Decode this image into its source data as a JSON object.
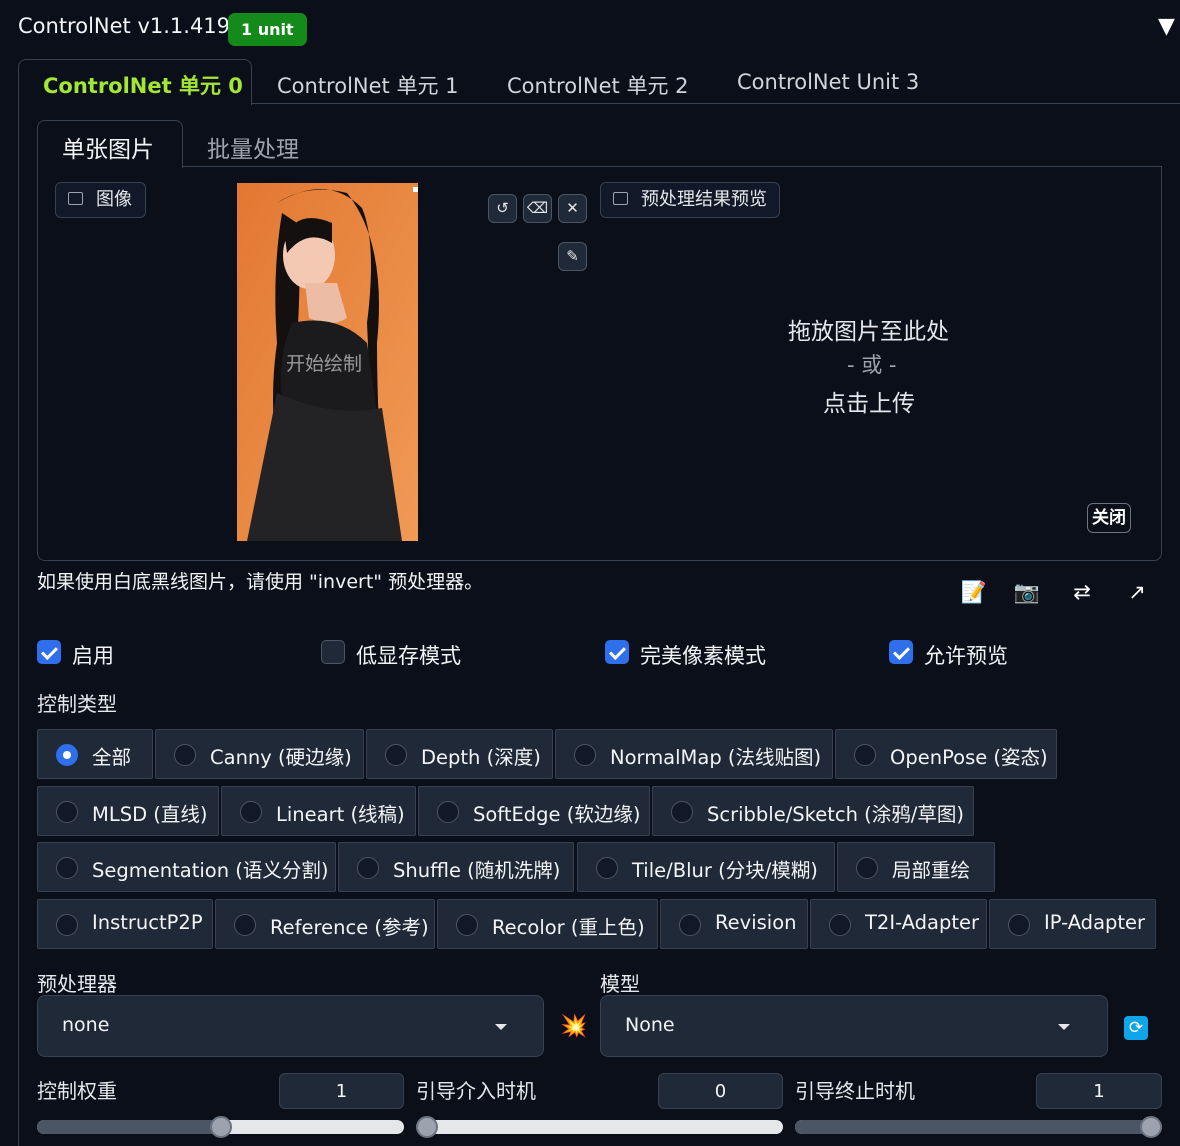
{
  "header": {
    "title": "ControlNet v1.1.419",
    "badge": "1 unit",
    "collapse_glyph": "▼"
  },
  "outer_tabs": [
    "ControlNet 单元 0",
    "ControlNet 单元 1",
    "ControlNet 单元 2",
    "ControlNet Unit 3"
  ],
  "inner_tabs": [
    "单张图片",
    "批量处理"
  ],
  "canvas": {
    "image_label": "图像",
    "preview_label": "预处理结果预览",
    "start_draw": "开始绘制",
    "drop_main": "拖放图片至此处",
    "drop_or": "- 或 -",
    "drop_click": "点击上传",
    "close": "关闭",
    "tool_glyphs": {
      "undo": "↺",
      "erase": "⌫",
      "clear": "✕",
      "brush": "✎"
    }
  },
  "hint": "如果使用白底黑线图片，请使用 \"invert\" 预处理器。",
  "toolbar_glyphs": {
    "edit": "📝",
    "camera": "📷",
    "swap": "⇄",
    "send": "↗"
  },
  "checkboxes": [
    {
      "label": "启用",
      "checked": true
    },
    {
      "label": "低显存模式",
      "checked": false
    },
    {
      "label": "完美像素模式",
      "checked": true
    },
    {
      "label": "允许预览",
      "checked": true
    }
  ],
  "control_type": {
    "label": "控制类型",
    "options": [
      "全部",
      "Canny (硬边缘)",
      "Depth (深度)",
      "NormalMap (法线贴图)",
      "OpenPose (姿态)",
      "MLSD (直线)",
      "Lineart (线稿)",
      "SoftEdge (软边缘)",
      "Scribble/Sketch (涂鸦/草图)",
      "Segmentation (语义分割)",
      "Shuffle (随机洗牌)",
      "Tile/Blur (分块/模糊)",
      "局部重绘",
      "InstructP2P",
      "Reference (参考)",
      "Recolor (重上色)",
      "Revision",
      "T2I-Adapter",
      "IP-Adapter"
    ],
    "selected": "全部"
  },
  "preprocessor": {
    "label": "预处理器",
    "value": "none"
  },
  "model": {
    "label": "模型",
    "value": "None"
  },
  "run_glyph": "💥",
  "refresh_glyph": "⟳",
  "sliders": [
    {
      "label": "控制权重",
      "value": "1",
      "fraction": 0.5
    },
    {
      "label": "引导介入时机",
      "value": "0",
      "fraction": 0.0
    },
    {
      "label": "引导终止时机",
      "value": "1",
      "fraction": 1.0
    }
  ],
  "colors": {
    "accent": "#2f6feb",
    "active_tab": "#a3e635",
    "badge": "#138a1a",
    "background": "#0b0f19"
  }
}
